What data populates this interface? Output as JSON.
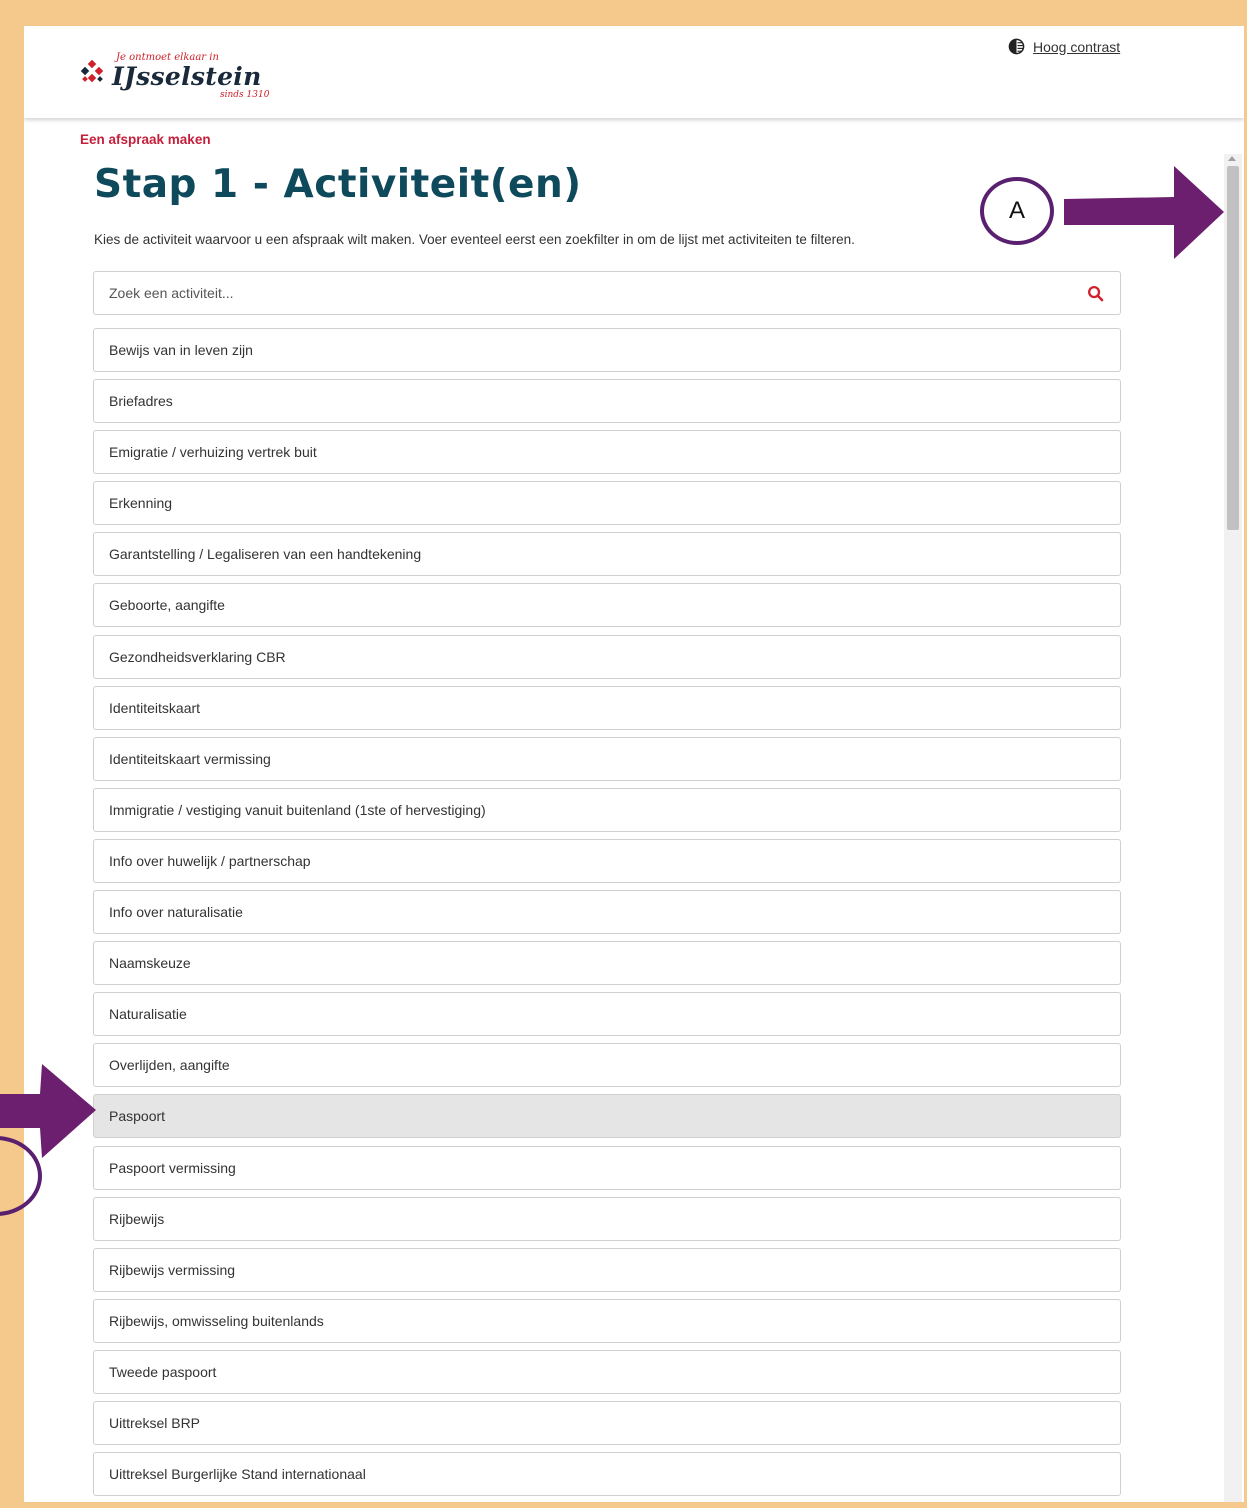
{
  "header": {
    "logo_tagline": "Je ontmoet elkaar in",
    "logo_name": "IJsselstein",
    "logo_since": "sinds 1310",
    "contrast_label": "Hoog contrast"
  },
  "breadcrumb": "Een afspraak maken",
  "page_title": "Stap 1 - Activiteit(en)",
  "intro": "Kies de activiteit waarvoor u een afspraak wilt maken. Voer eventeel eerst een zoekfilter in om de lijst met activiteiten te filteren.",
  "search": {
    "placeholder": "Zoek een activiteit...",
    "icon": "search-icon"
  },
  "activities": [
    "Bewijs van in leven zijn",
    "Briefadres",
    "Emigratie / verhuizing vertrek buit",
    "Erkenning",
    "Garantstelling / Legaliseren van een handtekening",
    "Geboorte, aangifte",
    "Gezondheidsverklaring CBR",
    "Identiteitskaart",
    "Identiteitskaart vermissing",
    "Immigratie / vestiging vanuit buitenland (1ste of hervestiging)",
    "Info over huwelijk / partnerschap",
    "Info over naturalisatie",
    "Naamskeuze",
    "Naturalisatie",
    "Overlijden, aangifte",
    "Paspoort",
    "Paspoort vermissing",
    "Rijbewijs",
    "Rijbewijs vermissing",
    "Rijbewijs, omwisseling buitenlands",
    "Tweede paspoort",
    "Uittreksel BRP",
    "Uittreksel Burgerlijke Stand internationaal"
  ],
  "selected_activity": "Paspoort",
  "annotation": {
    "label_a": "A",
    "color": "#6b1f6e"
  },
  "colors": {
    "accent_red": "#c41e3a",
    "title_teal": "#0f4a5c",
    "page_border": "#f5c88c",
    "selected_row": "#e5e5e5"
  }
}
